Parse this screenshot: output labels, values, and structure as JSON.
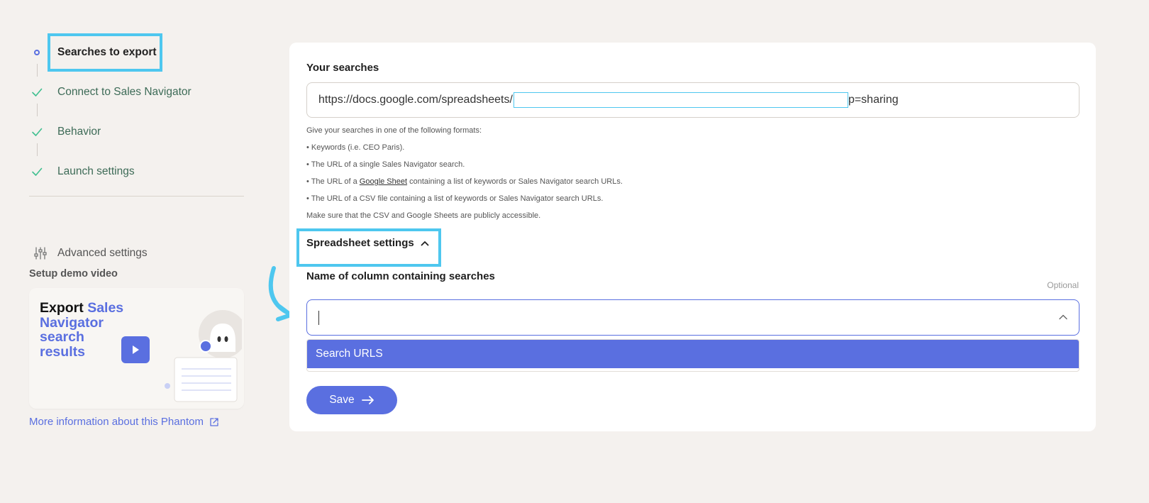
{
  "sidebar": {
    "steps": [
      {
        "label": "Searches to export",
        "state": "current"
      },
      {
        "label": "Connect to Sales Navigator",
        "state": "done"
      },
      {
        "label": "Behavior",
        "state": "done"
      },
      {
        "label": "Launch settings",
        "state": "done"
      }
    ],
    "advanced_label": "Advanced settings",
    "demo_heading": "Setup demo video",
    "demo_card": {
      "title_dark": "Export ",
      "title_accent": "Sales Navigator search results"
    },
    "more_info": "More information about this Phantom"
  },
  "main": {
    "searches": {
      "label": "Your searches",
      "value_prefix": "https://docs.google.com/spreadsheets/",
      "value_suffix": "p=sharing"
    },
    "help": {
      "intro": "Give your searches in one of the following formats:",
      "item1": "• Keywords (i.e. CEO Paris).",
      "item2": "• The URL of a single Sales Navigator search.",
      "item3_pre": "• The URL of a ",
      "item3_link": "Google Sheet",
      "item3_post": " containing a list of keywords or Sales Navigator search URLs.",
      "item4": "• The URL of a CSV file containing a list of keywords or Sales Navigator search URLs.",
      "note": "Make sure that the CSV and Google Sheets are publicly accessible."
    },
    "spreadsheet_settings": "Spreadsheet settings",
    "column": {
      "label": "Name of column containing searches",
      "optional": "Optional",
      "value": "",
      "options": [
        "Search URLS"
      ]
    },
    "save_label": "Save"
  },
  "colors": {
    "accent": "#5a6fe0",
    "highlight": "#4ec7ef",
    "success": "#3d6b57",
    "background": "#f4f1ee"
  }
}
